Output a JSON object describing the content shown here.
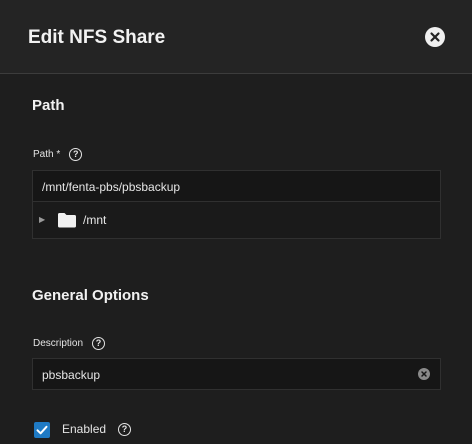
{
  "dialog": {
    "title": "Edit NFS Share",
    "close_icon": "close-icon"
  },
  "path_section": {
    "title": "Path",
    "label": "Path *",
    "help_icon": "help-icon",
    "value": "/mnt/fenta-pbs/pbsbackup",
    "tree": {
      "expand_icon": "triangle-right-icon",
      "folder_icon": "folder-icon",
      "root_label": "/mnt",
      "expanded": false
    }
  },
  "general_section": {
    "title": "General Options",
    "description": {
      "label": "Description",
      "value": "pbsbackup",
      "clear_icon": "clear-icon"
    },
    "enabled": {
      "label": "Enabled",
      "checked": true
    }
  },
  "colors": {
    "accent": "#1f7ac4",
    "background": "#1e1e1e",
    "header_background": "#242424",
    "input_background": "#161616"
  }
}
